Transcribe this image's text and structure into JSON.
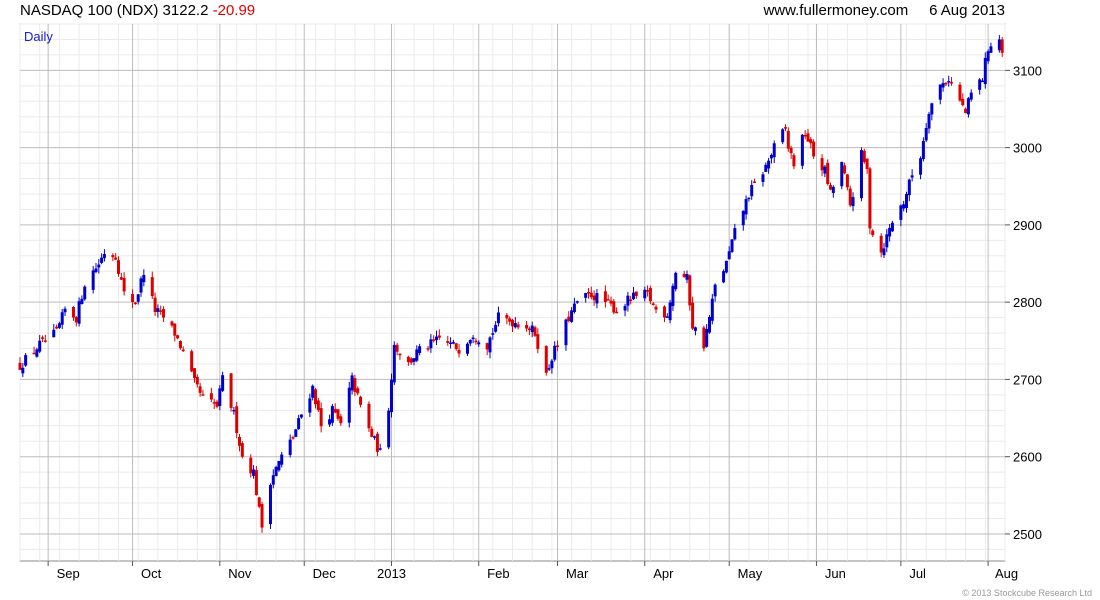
{
  "header": {
    "instrument": "NASDAQ 100 (NDX)",
    "last": "3122.2",
    "change": "-20.99",
    "website": "www.fullermoney.com",
    "date": "6 Aug 2013"
  },
  "chart_data": {
    "type": "candlestick",
    "title": "NASDAQ 100 (NDX)",
    "period_label": "Daily",
    "x_tick_labels": [
      "Sep",
      "Oct",
      "Nov",
      "Dec",
      "2013",
      "Feb",
      "Mar",
      "Apr",
      "May",
      "Jun",
      "Jul",
      "Aug"
    ],
    "y_tick_labels": [
      2500,
      2600,
      2700,
      2800,
      2900,
      3000,
      3100
    ],
    "ylim": [
      2465,
      3160
    ],
    "x_range": [
      "2012-08-22",
      "2013-08-07"
    ],
    "grid": true,
    "up_color": "#0000cc",
    "down_color": "#dd0000",
    "closes": [
      [
        "2012-08-22",
        2718
      ],
      [
        "2012-08-29",
        2745
      ],
      [
        "2012-09-04",
        2760
      ],
      [
        "2012-09-07",
        2790
      ],
      [
        "2012-09-11",
        2780
      ],
      [
        "2012-09-14",
        2825
      ],
      [
        "2012-09-19",
        2850
      ],
      [
        "2012-09-21",
        2865
      ],
      [
        "2012-09-25",
        2860
      ],
      [
        "2012-09-28",
        2810
      ],
      [
        "2012-10-02",
        2800
      ],
      [
        "2012-10-05",
        2840
      ],
      [
        "2012-10-09",
        2790
      ],
      [
        "2012-10-12",
        2780
      ],
      [
        "2012-10-16",
        2760
      ],
      [
        "2012-10-19",
        2735
      ],
      [
        "2012-10-23",
        2695
      ],
      [
        "2012-10-26",
        2675
      ],
      [
        "2012-10-31",
        2665
      ],
      [
        "2012-11-02",
        2700
      ],
      [
        "2012-11-06",
        2655
      ],
      [
        "2012-11-09",
        2600
      ],
      [
        "2012-11-13",
        2580
      ],
      [
        "2012-11-15",
        2530
      ],
      [
        "2012-11-16",
        2510
      ],
      [
        "2012-11-19",
        2570
      ],
      [
        "2012-11-23",
        2600
      ],
      [
        "2012-11-27",
        2625
      ],
      [
        "2012-11-30",
        2655
      ],
      [
        "2012-12-04",
        2690
      ],
      [
        "2012-12-07",
        2640
      ],
      [
        "2012-12-11",
        2660
      ],
      [
        "2012-12-14",
        2640
      ],
      [
        "2012-12-18",
        2700
      ],
      [
        "2012-12-21",
        2665
      ],
      [
        "2012-12-24",
        2635
      ],
      [
        "2012-12-28",
        2605
      ],
      [
        "2012-12-31",
        2665
      ],
      [
        "2013-01-02",
        2745
      ],
      [
        "2013-01-07",
        2720
      ],
      [
        "2013-01-10",
        2735
      ],
      [
        "2013-01-15",
        2745
      ],
      [
        "2013-01-18",
        2752
      ],
      [
        "2013-01-22",
        2745
      ],
      [
        "2013-01-25",
        2740
      ],
      [
        "2013-01-30",
        2760
      ],
      [
        "2013-02-04",
        2745
      ],
      [
        "2013-02-08",
        2780
      ],
      [
        "2013-02-13",
        2775
      ],
      [
        "2013-02-18",
        2770
      ],
      [
        "2013-02-21",
        2760
      ],
      [
        "2013-02-25",
        2705
      ],
      [
        "2013-02-27",
        2730
      ],
      [
        "2013-03-01",
        2745
      ],
      [
        "2013-03-05",
        2780
      ],
      [
        "2013-03-08",
        2800
      ],
      [
        "2013-03-13",
        2810
      ],
      [
        "2013-03-18",
        2800
      ],
      [
        "2013-03-22",
        2790
      ],
      [
        "2013-03-27",
        2805
      ],
      [
        "2013-04-02",
        2810
      ],
      [
        "2013-04-05",
        2790
      ],
      [
        "2013-04-09",
        2785
      ],
      [
        "2013-04-12",
        2840
      ],
      [
        "2013-04-16",
        2830
      ],
      [
        "2013-04-18",
        2770
      ],
      [
        "2013-04-22",
        2745
      ],
      [
        "2013-04-24",
        2780
      ],
      [
        "2013-04-26",
        2820
      ],
      [
        "2013-04-30",
        2850
      ],
      [
        "2013-05-03",
        2890
      ],
      [
        "2013-05-08",
        2940
      ],
      [
        "2013-05-14",
        2975
      ],
      [
        "2013-05-17",
        3000
      ],
      [
        "2013-05-21",
        3025
      ],
      [
        "2013-05-22",
        3000
      ],
      [
        "2013-05-24",
        2980
      ],
      [
        "2013-05-28",
        3020
      ],
      [
        "2013-05-31",
        2990
      ],
      [
        "2013-06-04",
        2970
      ],
      [
        "2013-06-06",
        2940
      ],
      [
        "2013-06-10",
        2980
      ],
      [
        "2013-06-13",
        2925
      ],
      [
        "2013-06-17",
        2990
      ],
      [
        "2013-06-19",
        2970
      ],
      [
        "2013-06-20",
        2900
      ],
      [
        "2013-06-24",
        2865
      ],
      [
        "2013-06-26",
        2885
      ],
      [
        "2013-06-28",
        2905
      ],
      [
        "2013-07-02",
        2930
      ],
      [
        "2013-07-05",
        2965
      ],
      [
        "2013-07-08",
        2990
      ],
      [
        "2013-07-11",
        3050
      ],
      [
        "2013-07-15",
        3080
      ],
      [
        "2013-07-18",
        3090
      ],
      [
        "2013-07-22",
        3060
      ],
      [
        "2013-07-24",
        3045
      ],
      [
        "2013-07-26",
        3070
      ],
      [
        "2013-07-30",
        3090
      ],
      [
        "2013-08-01",
        3130
      ],
      [
        "2013-08-05",
        3140
      ],
      [
        "2013-08-06",
        3122.2
      ]
    ]
  },
  "copyright": "© 2013 Stockcube Research Ltd"
}
